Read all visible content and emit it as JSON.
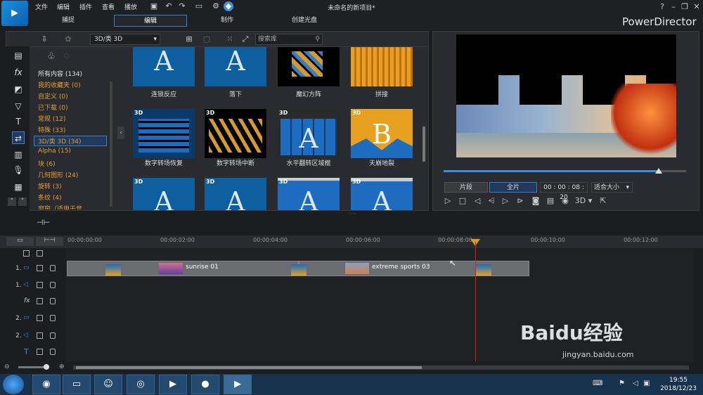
{
  "menubar": {
    "items": [
      "文件",
      "编辑",
      "插件",
      "查看",
      "播放"
    ],
    "title": "未命名的新项目*",
    "win_buttons": [
      "?",
      "–",
      "❐",
      "✕"
    ]
  },
  "tabs": [
    "捕捉",
    "编辑",
    "制作",
    "创建光盘"
  ],
  "brand": "PowerDirector",
  "library": {
    "dropdown": "3D/类 3D",
    "search_placeholder": "搜索库",
    "categories": [
      "所有内容 (134)",
      "我的收藏夹 (0)",
      "自定义 (0)",
      "已下载 (0)",
      "常规 (12)",
      "特殊 (33)",
      "3D/类 3D (34)",
      "Alpha (15)",
      "块 (6)",
      "几何图形 (24)",
      "旋转 (3)",
      "条纹 (4)",
      "窗帘（适用于音..."
    ],
    "thumbs": [
      {
        "label": "连锁反应",
        "badge": ""
      },
      {
        "label": "落下",
        "badge": ""
      },
      {
        "label": "魔幻方阵",
        "badge": ""
      },
      {
        "label": "拼接",
        "badge": ""
      },
      {
        "label": "数字转场恢复",
        "badge": "3D"
      },
      {
        "label": "数字转场中断",
        "badge": "3D"
      },
      {
        "label": "水平翻转区域框",
        "badge": "3D"
      },
      {
        "label": "天崩地裂",
        "badge": "3D"
      },
      {
        "label": "",
        "badge": "3D"
      },
      {
        "label": "",
        "badge": "3D"
      },
      {
        "label": "",
        "badge": "3D"
      },
      {
        "label": "",
        "badge": "3D"
      }
    ]
  },
  "preview": {
    "btn_clip": "片段",
    "btn_movie": "全片",
    "timecode": "00 : 00 : 08 : 20",
    "fit": "适合大小",
    "mode3d": "3D",
    "progress": 0.88
  },
  "timeline": {
    "ruler": [
      "00:00:00:00",
      "00:00:02:00",
      "00:00:04:00",
      "00:00:06:00",
      "00:00:08:00",
      "00:00:10:00",
      "00:00:12:00"
    ],
    "tracks": [
      "1.",
      "1.",
      "fx",
      "2.",
      "2.",
      "T"
    ],
    "clips": [
      "sunrise 01",
      "extreme sports 03"
    ]
  },
  "taskbar": {
    "time": "19:55",
    "date": "2018/12/23"
  },
  "watermark": {
    "main": "Baidu经验",
    "url": "jingyan.baidu.com"
  }
}
